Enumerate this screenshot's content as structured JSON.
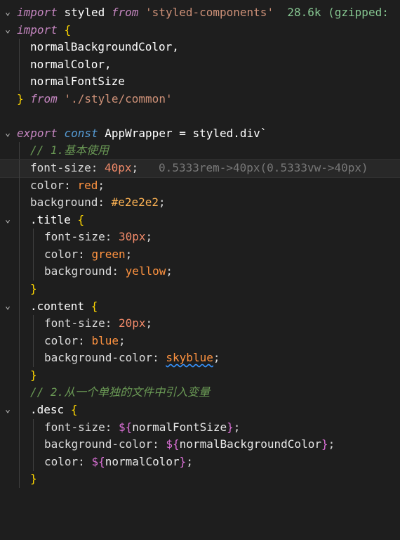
{
  "editor": {
    "line1": {
      "kw": "import",
      "name": "styled",
      "from": "from",
      "module": "'styled-components'",
      "size_hint": "28.6k (gzipped:"
    },
    "line2": {
      "kw": "import",
      "open": "{"
    },
    "line3": {
      "name": "normalBackgroundColor,"
    },
    "line4": {
      "name": "normalColor,"
    },
    "line5": {
      "name": "normalFontSize"
    },
    "line6": {
      "close": "}",
      "from": "from",
      "module": "'./style/common'"
    },
    "line8": {
      "export": "export",
      "const": "const",
      "name": "AppWrapper",
      "eq": " = ",
      "styled": "styled.div`"
    },
    "line9": {
      "comment": "// 1.基本使用"
    },
    "line10": {
      "prop": "font-size:",
      "value": "40px",
      "semi": ";",
      "hint": "0.5333rem->40px(0.5333vw->40px)"
    },
    "line11": {
      "prop": "color:",
      "value": "red",
      "semi": ";"
    },
    "line12": {
      "prop": "background:",
      "value": "#e2e2e2",
      "semi": ";"
    },
    "line13": {
      "selector": ".title",
      "open": "{"
    },
    "line14": {
      "prop": "font-size:",
      "value": "30px",
      "semi": ";"
    },
    "line15": {
      "prop": "color:",
      "value": "green",
      "semi": ";"
    },
    "line16": {
      "prop": "background:",
      "value": "yellow",
      "semi": ";"
    },
    "line17": {
      "close": "}"
    },
    "line18": {
      "selector": ".content",
      "open": "{"
    },
    "line19": {
      "prop": "font-size:",
      "value": "20px",
      "semi": ";"
    },
    "line20": {
      "prop": "color:",
      "value": "blue",
      "semi": ";"
    },
    "line21": {
      "prop": "background-color:",
      "value": "skyblue",
      "semi": ";"
    },
    "line22": {
      "close": "}"
    },
    "line23": {
      "comment": "// 2.从一个单独的文件中引入变量"
    },
    "line24": {
      "selector": ".desc",
      "open": "{"
    },
    "line25": {
      "prop": "font-size:",
      "d": "${",
      "var": "normalFontSize",
      "c": "}",
      "semi": ";"
    },
    "line26": {
      "prop": "background-color:",
      "d": "${",
      "var": "normalBackgroundColor",
      "c": "}",
      "semi": ";"
    },
    "line27": {
      "prop": "color:",
      "d": "${",
      "var": "normalColor",
      "c": "}",
      "semi": ";"
    },
    "line28": {
      "close": "}"
    }
  }
}
